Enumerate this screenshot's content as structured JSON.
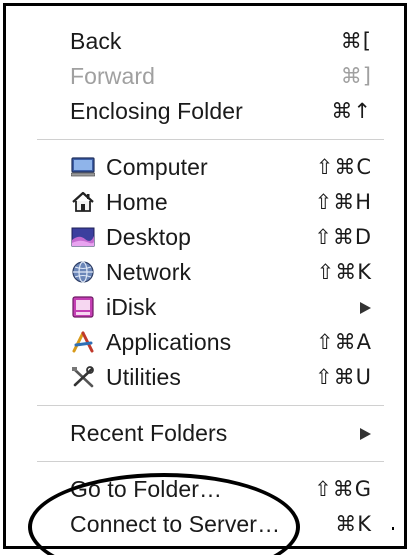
{
  "menu": {
    "navigation": [
      {
        "label": "Back",
        "shortcut": "⌘[",
        "enabled": true
      },
      {
        "label": "Forward",
        "shortcut": "⌘]",
        "enabled": false
      },
      {
        "label": "Enclosing Folder",
        "shortcut": "⌘↑",
        "enabled": true
      }
    ],
    "places": [
      {
        "label": "Computer",
        "icon": "computer-icon",
        "shortcut": "⇧⌘C"
      },
      {
        "label": "Home",
        "icon": "home-icon",
        "shortcut": "⇧⌘H"
      },
      {
        "label": "Desktop",
        "icon": "desktop-icon",
        "shortcut": "⇧⌘D"
      },
      {
        "label": "Network",
        "icon": "network-icon",
        "shortcut": "⇧⌘K"
      },
      {
        "label": "iDisk",
        "icon": "idisk-icon",
        "submenu": true
      },
      {
        "label": "Applications",
        "icon": "applications-icon",
        "shortcut": "⇧⌘A"
      },
      {
        "label": "Utilities",
        "icon": "utilities-icon",
        "shortcut": "⇧⌘U"
      }
    ],
    "recent": {
      "label": "Recent Folders",
      "submenu": true
    },
    "go": [
      {
        "label": "Go to Folder…",
        "shortcut": "⇧⌘G"
      },
      {
        "label": "Connect to Server…",
        "shortcut": "⌘K"
      }
    ]
  },
  "colors": {
    "text": "#1a1a1a",
    "disabled_text": "#a0a0a0",
    "separator": "#d0d0d0",
    "annotation": "#000000"
  }
}
